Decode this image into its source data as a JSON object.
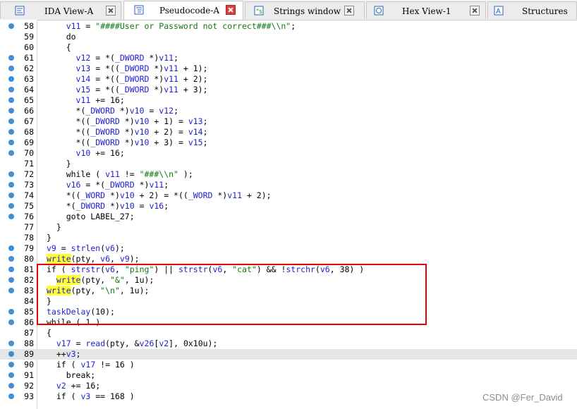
{
  "tabs": [
    {
      "label": "IDA View-A",
      "icon": "ida-view-icon",
      "active": false,
      "closable": true
    },
    {
      "label": "Pseudocode-A",
      "icon": "pseudocode-icon",
      "active": true,
      "closable": true
    },
    {
      "label": "Strings window",
      "icon": "strings-icon",
      "active": false,
      "closable": true
    },
    {
      "label": "Hex View-1",
      "icon": "hex-view-icon",
      "active": false,
      "closable": true
    },
    {
      "label": "Structures",
      "icon": "structures-icon",
      "active": false,
      "closable": false
    }
  ],
  "code_lines": [
    {
      "num": "58",
      "dot": true,
      "text": "    v11 = \"####User or Password not correct###\\\\n\";"
    },
    {
      "num": "59",
      "dot": false,
      "text": "    do"
    },
    {
      "num": "60",
      "dot": false,
      "text": "    {"
    },
    {
      "num": "61",
      "dot": true,
      "text": "      v12 = *(_DWORD *)v11;"
    },
    {
      "num": "62",
      "dot": true,
      "text": "      v13 = *((_DWORD *)v11 + 1);"
    },
    {
      "num": "63",
      "dot": true,
      "text": "      v14 = *((_DWORD *)v11 + 2);"
    },
    {
      "num": "64",
      "dot": true,
      "text": "      v15 = *((_DWORD *)v11 + 3);"
    },
    {
      "num": "65",
      "dot": true,
      "text": "      v11 += 16;"
    },
    {
      "num": "66",
      "dot": true,
      "text": "      *(_DWORD *)v10 = v12;"
    },
    {
      "num": "67",
      "dot": true,
      "text": "      *((_DWORD *)v10 + 1) = v13;"
    },
    {
      "num": "68",
      "dot": true,
      "text": "      *((_DWORD *)v10 + 2) = v14;"
    },
    {
      "num": "69",
      "dot": true,
      "text": "      *((_DWORD *)v10 + 3) = v15;"
    },
    {
      "num": "70",
      "dot": true,
      "text": "      v10 += 16;"
    },
    {
      "num": "71",
      "dot": false,
      "text": "    }"
    },
    {
      "num": "72",
      "dot": true,
      "text": "    while ( v11 != \"###\\\\n\" );"
    },
    {
      "num": "73",
      "dot": true,
      "text": "    v16 = *(_DWORD *)v11;"
    },
    {
      "num": "74",
      "dot": true,
      "text": "    *((_WORD *)v10 + 2) = *((_WORD *)v11 + 2);"
    },
    {
      "num": "75",
      "dot": true,
      "text": "    *(_DWORD *)v10 = v16;"
    },
    {
      "num": "76",
      "dot": true,
      "text": "    goto LABEL_27;"
    },
    {
      "num": "77",
      "dot": false,
      "text": "  }"
    },
    {
      "num": "78",
      "dot": false,
      "text": "}"
    },
    {
      "num": "79",
      "dot": true,
      "text": "v9 = strlen(v6);"
    },
    {
      "num": "80",
      "dot": true,
      "text": "write(pty, v6, v9);"
    },
    {
      "num": "81",
      "dot": true,
      "text": "if ( strstr(v6, \"ping\") || strstr(v6, \"cat\") && !strchr(v6, 38) )"
    },
    {
      "num": "82",
      "dot": true,
      "text": "  write(pty, \"&\", 1u);"
    },
    {
      "num": "83",
      "dot": true,
      "text": "write(pty, \"\\n\", 1u);"
    },
    {
      "num": "84",
      "dot": false,
      "text": "}"
    },
    {
      "num": "85",
      "dot": true,
      "text": "taskDelay(10);"
    },
    {
      "num": "86",
      "dot": true,
      "text": "while ( 1 )"
    },
    {
      "num": "87",
      "dot": false,
      "text": "{"
    },
    {
      "num": "88",
      "dot": true,
      "text": "  v17 = read(pty, &v26[v2], 0x10u);"
    },
    {
      "num": "89",
      "dot": true,
      "text": "  ++v3;",
      "highlighted": true
    },
    {
      "num": "90",
      "dot": true,
      "text": "  if ( v17 != 16 )"
    },
    {
      "num": "91",
      "dot": true,
      "text": "    break;"
    },
    {
      "num": "92",
      "dot": true,
      "text": "  v2 += 16;"
    },
    {
      "num": "93",
      "dot": true,
      "text": "  if ( v3 == 168 )"
    }
  ],
  "colors": {
    "identifier": "#1e1ecf",
    "string": "#0f7a0f",
    "highlight_write": "#ffff33",
    "annotation_box": "#e60000",
    "breakpoint_dot": "#3d8fd6"
  },
  "watermark": "CSDN @Fer_David"
}
